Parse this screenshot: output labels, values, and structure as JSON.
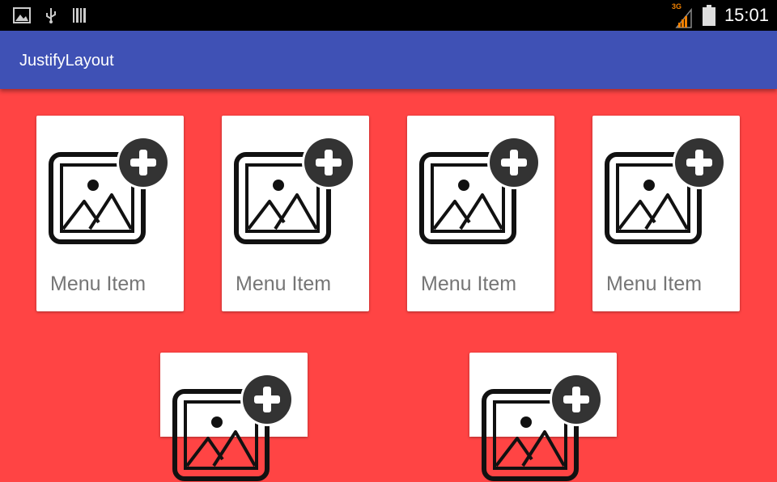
{
  "status_bar": {
    "time": "15:01",
    "network": "3G",
    "icons": [
      "image-notification-icon",
      "usb-icon",
      "barcode-icon",
      "signal-icon",
      "battery-icon"
    ]
  },
  "app_bar": {
    "title": "JustifyLayout",
    "color": "#3f51b5"
  },
  "content": {
    "background": "#ff4444",
    "items": [
      {
        "label": "Menu Item",
        "icon": "add-photo-icon"
      },
      {
        "label": "Menu Item",
        "icon": "add-photo-icon"
      },
      {
        "label": "Menu Item",
        "icon": "add-photo-icon"
      },
      {
        "label": "Menu Item",
        "icon": "add-photo-icon"
      },
      {
        "label": "",
        "icon": "add-photo-icon"
      },
      {
        "label": "",
        "icon": "add-photo-icon"
      }
    ]
  }
}
